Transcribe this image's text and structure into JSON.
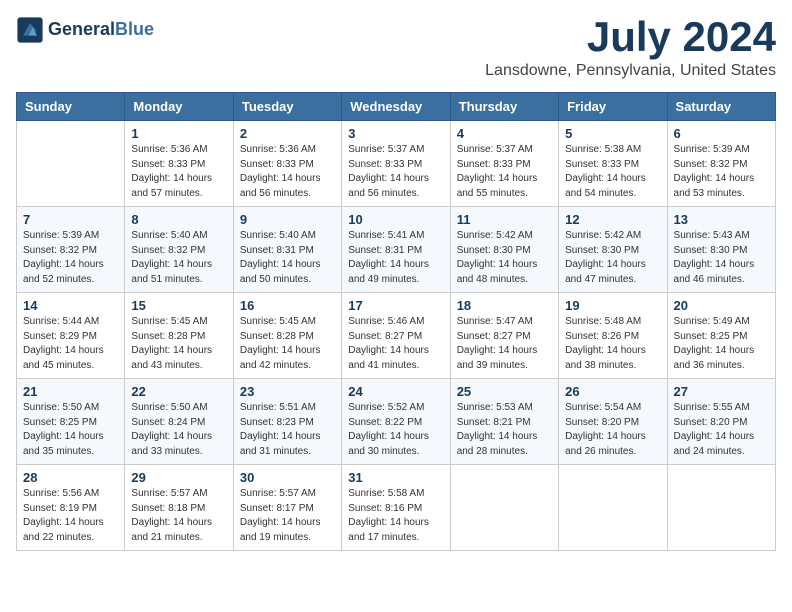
{
  "logo": {
    "text_general": "General",
    "text_blue": "Blue"
  },
  "title": "July 2024",
  "subtitle": "Lansdowne, Pennsylvania, United States",
  "header_row": [
    "Sunday",
    "Monday",
    "Tuesday",
    "Wednesday",
    "Thursday",
    "Friday",
    "Saturday"
  ],
  "weeks": [
    [
      {
        "day": "",
        "sunrise": "",
        "sunset": "",
        "daylight": ""
      },
      {
        "day": "1",
        "sunrise": "Sunrise: 5:36 AM",
        "sunset": "Sunset: 8:33 PM",
        "daylight": "Daylight: 14 hours and 57 minutes."
      },
      {
        "day": "2",
        "sunrise": "Sunrise: 5:36 AM",
        "sunset": "Sunset: 8:33 PM",
        "daylight": "Daylight: 14 hours and 56 minutes."
      },
      {
        "day": "3",
        "sunrise": "Sunrise: 5:37 AM",
        "sunset": "Sunset: 8:33 PM",
        "daylight": "Daylight: 14 hours and 56 minutes."
      },
      {
        "day": "4",
        "sunrise": "Sunrise: 5:37 AM",
        "sunset": "Sunset: 8:33 PM",
        "daylight": "Daylight: 14 hours and 55 minutes."
      },
      {
        "day": "5",
        "sunrise": "Sunrise: 5:38 AM",
        "sunset": "Sunset: 8:33 PM",
        "daylight": "Daylight: 14 hours and 54 minutes."
      },
      {
        "day": "6",
        "sunrise": "Sunrise: 5:39 AM",
        "sunset": "Sunset: 8:32 PM",
        "daylight": "Daylight: 14 hours and 53 minutes."
      }
    ],
    [
      {
        "day": "7",
        "sunrise": "Sunrise: 5:39 AM",
        "sunset": "Sunset: 8:32 PM",
        "daylight": "Daylight: 14 hours and 52 minutes."
      },
      {
        "day": "8",
        "sunrise": "Sunrise: 5:40 AM",
        "sunset": "Sunset: 8:32 PM",
        "daylight": "Daylight: 14 hours and 51 minutes."
      },
      {
        "day": "9",
        "sunrise": "Sunrise: 5:40 AM",
        "sunset": "Sunset: 8:31 PM",
        "daylight": "Daylight: 14 hours and 50 minutes."
      },
      {
        "day": "10",
        "sunrise": "Sunrise: 5:41 AM",
        "sunset": "Sunset: 8:31 PM",
        "daylight": "Daylight: 14 hours and 49 minutes."
      },
      {
        "day": "11",
        "sunrise": "Sunrise: 5:42 AM",
        "sunset": "Sunset: 8:30 PM",
        "daylight": "Daylight: 14 hours and 48 minutes."
      },
      {
        "day": "12",
        "sunrise": "Sunrise: 5:42 AM",
        "sunset": "Sunset: 8:30 PM",
        "daylight": "Daylight: 14 hours and 47 minutes."
      },
      {
        "day": "13",
        "sunrise": "Sunrise: 5:43 AM",
        "sunset": "Sunset: 8:30 PM",
        "daylight": "Daylight: 14 hours and 46 minutes."
      }
    ],
    [
      {
        "day": "14",
        "sunrise": "Sunrise: 5:44 AM",
        "sunset": "Sunset: 8:29 PM",
        "daylight": "Daylight: 14 hours and 45 minutes."
      },
      {
        "day": "15",
        "sunrise": "Sunrise: 5:45 AM",
        "sunset": "Sunset: 8:28 PM",
        "daylight": "Daylight: 14 hours and 43 minutes."
      },
      {
        "day": "16",
        "sunrise": "Sunrise: 5:45 AM",
        "sunset": "Sunset: 8:28 PM",
        "daylight": "Daylight: 14 hours and 42 minutes."
      },
      {
        "day": "17",
        "sunrise": "Sunrise: 5:46 AM",
        "sunset": "Sunset: 8:27 PM",
        "daylight": "Daylight: 14 hours and 41 minutes."
      },
      {
        "day": "18",
        "sunrise": "Sunrise: 5:47 AM",
        "sunset": "Sunset: 8:27 PM",
        "daylight": "Daylight: 14 hours and 39 minutes."
      },
      {
        "day": "19",
        "sunrise": "Sunrise: 5:48 AM",
        "sunset": "Sunset: 8:26 PM",
        "daylight": "Daylight: 14 hours and 38 minutes."
      },
      {
        "day": "20",
        "sunrise": "Sunrise: 5:49 AM",
        "sunset": "Sunset: 8:25 PM",
        "daylight": "Daylight: 14 hours and 36 minutes."
      }
    ],
    [
      {
        "day": "21",
        "sunrise": "Sunrise: 5:50 AM",
        "sunset": "Sunset: 8:25 PM",
        "daylight": "Daylight: 14 hours and 35 minutes."
      },
      {
        "day": "22",
        "sunrise": "Sunrise: 5:50 AM",
        "sunset": "Sunset: 8:24 PM",
        "daylight": "Daylight: 14 hours and 33 minutes."
      },
      {
        "day": "23",
        "sunrise": "Sunrise: 5:51 AM",
        "sunset": "Sunset: 8:23 PM",
        "daylight": "Daylight: 14 hours and 31 minutes."
      },
      {
        "day": "24",
        "sunrise": "Sunrise: 5:52 AM",
        "sunset": "Sunset: 8:22 PM",
        "daylight": "Daylight: 14 hours and 30 minutes."
      },
      {
        "day": "25",
        "sunrise": "Sunrise: 5:53 AM",
        "sunset": "Sunset: 8:21 PM",
        "daylight": "Daylight: 14 hours and 28 minutes."
      },
      {
        "day": "26",
        "sunrise": "Sunrise: 5:54 AM",
        "sunset": "Sunset: 8:20 PM",
        "daylight": "Daylight: 14 hours and 26 minutes."
      },
      {
        "day": "27",
        "sunrise": "Sunrise: 5:55 AM",
        "sunset": "Sunset: 8:20 PM",
        "daylight": "Daylight: 14 hours and 24 minutes."
      }
    ],
    [
      {
        "day": "28",
        "sunrise": "Sunrise: 5:56 AM",
        "sunset": "Sunset: 8:19 PM",
        "daylight": "Daylight: 14 hours and 22 minutes."
      },
      {
        "day": "29",
        "sunrise": "Sunrise: 5:57 AM",
        "sunset": "Sunset: 8:18 PM",
        "daylight": "Daylight: 14 hours and 21 minutes."
      },
      {
        "day": "30",
        "sunrise": "Sunrise: 5:57 AM",
        "sunset": "Sunset: 8:17 PM",
        "daylight": "Daylight: 14 hours and 19 minutes."
      },
      {
        "day": "31",
        "sunrise": "Sunrise: 5:58 AM",
        "sunset": "Sunset: 8:16 PM",
        "daylight": "Daylight: 14 hours and 17 minutes."
      },
      {
        "day": "",
        "sunrise": "",
        "sunset": "",
        "daylight": ""
      },
      {
        "day": "",
        "sunrise": "",
        "sunset": "",
        "daylight": ""
      },
      {
        "day": "",
        "sunrise": "",
        "sunset": "",
        "daylight": ""
      }
    ]
  ]
}
